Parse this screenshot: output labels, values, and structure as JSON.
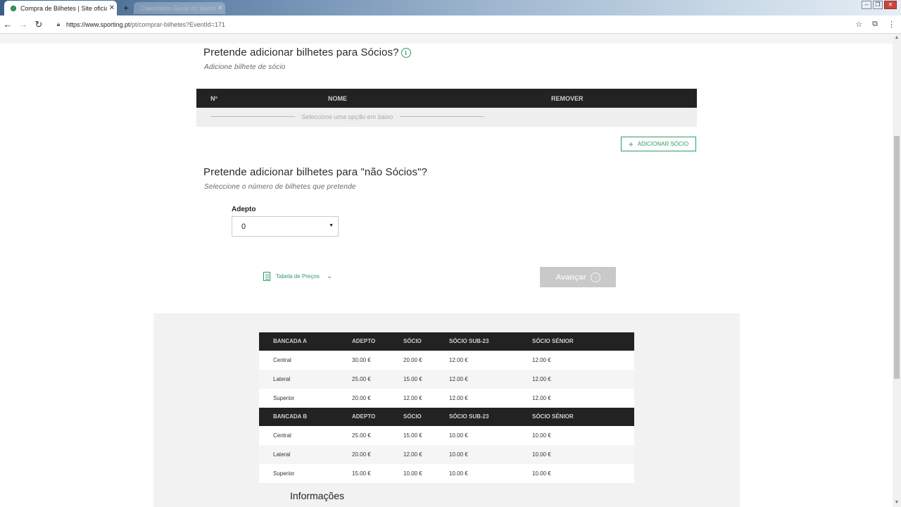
{
  "browser": {
    "tab_title": "Compra de Bilhetes | Site oficial d",
    "tab2_title": "Calendário Geral do Sporting",
    "url_host": "https://www.sporting.pt",
    "url_path": "/pt/comprar-bilhetes?EventId=171"
  },
  "socios": {
    "title": "Pretende adicionar bilhetes para Sócios?",
    "subtitle": "Adicione bilhete de sócio",
    "col_num": "Nº",
    "col_nome": "NOME",
    "col_remover": "REMOVER",
    "empty_text": "Seleccione uma opção em baixo",
    "add_button": "ADICIONAR SÓCIO"
  },
  "nao_socios": {
    "title": "Pretende adicionar bilhetes para \"não Sócios\"?",
    "subtitle": "Seleccione o número de bilhetes que pretende",
    "field_label": "Adepto",
    "field_value": "0"
  },
  "actions": {
    "price_table_toggle": "Tabela de Preços",
    "next_button": "Avançar"
  },
  "price_table": {
    "groups": [
      {
        "headers": [
          "BANCADA A",
          "ADEPTO",
          "SÓCIO",
          "SÓCIO SUB-23",
          "SÓCIO SÉNIOR"
        ],
        "rows": [
          [
            "Central",
            "30.00 €",
            "20.00 €",
            "12.00 €",
            "12.00 €"
          ],
          [
            "Lateral",
            "25.00 €",
            "15.00 €",
            "12.00 €",
            "12.00 €"
          ],
          [
            "Superior",
            "20.00 €",
            "12.00 €",
            "12.00 €",
            "12.00 €"
          ]
        ]
      },
      {
        "headers": [
          "BANCADA B",
          "ADEPTO",
          "SÓCIO",
          "SÓCIO SUB-23",
          "SÓCIO SÉNIOR"
        ],
        "rows": [
          [
            "Central",
            "25.00 €",
            "15.00 €",
            "10.00 €",
            "10.00 €"
          ],
          [
            "Lateral",
            "20.00 €",
            "12.00 €",
            "10.00 €",
            "10.00 €"
          ],
          [
            "Superior",
            "15.00 €",
            "10.00 €",
            "10.00 €",
            "10.00 €"
          ]
        ]
      }
    ]
  },
  "informacoes": {
    "title": "Informações"
  },
  "colors": {
    "accent": "#2e9c63",
    "table_header": "#222222",
    "panel_bg": "#f2f2f2"
  }
}
